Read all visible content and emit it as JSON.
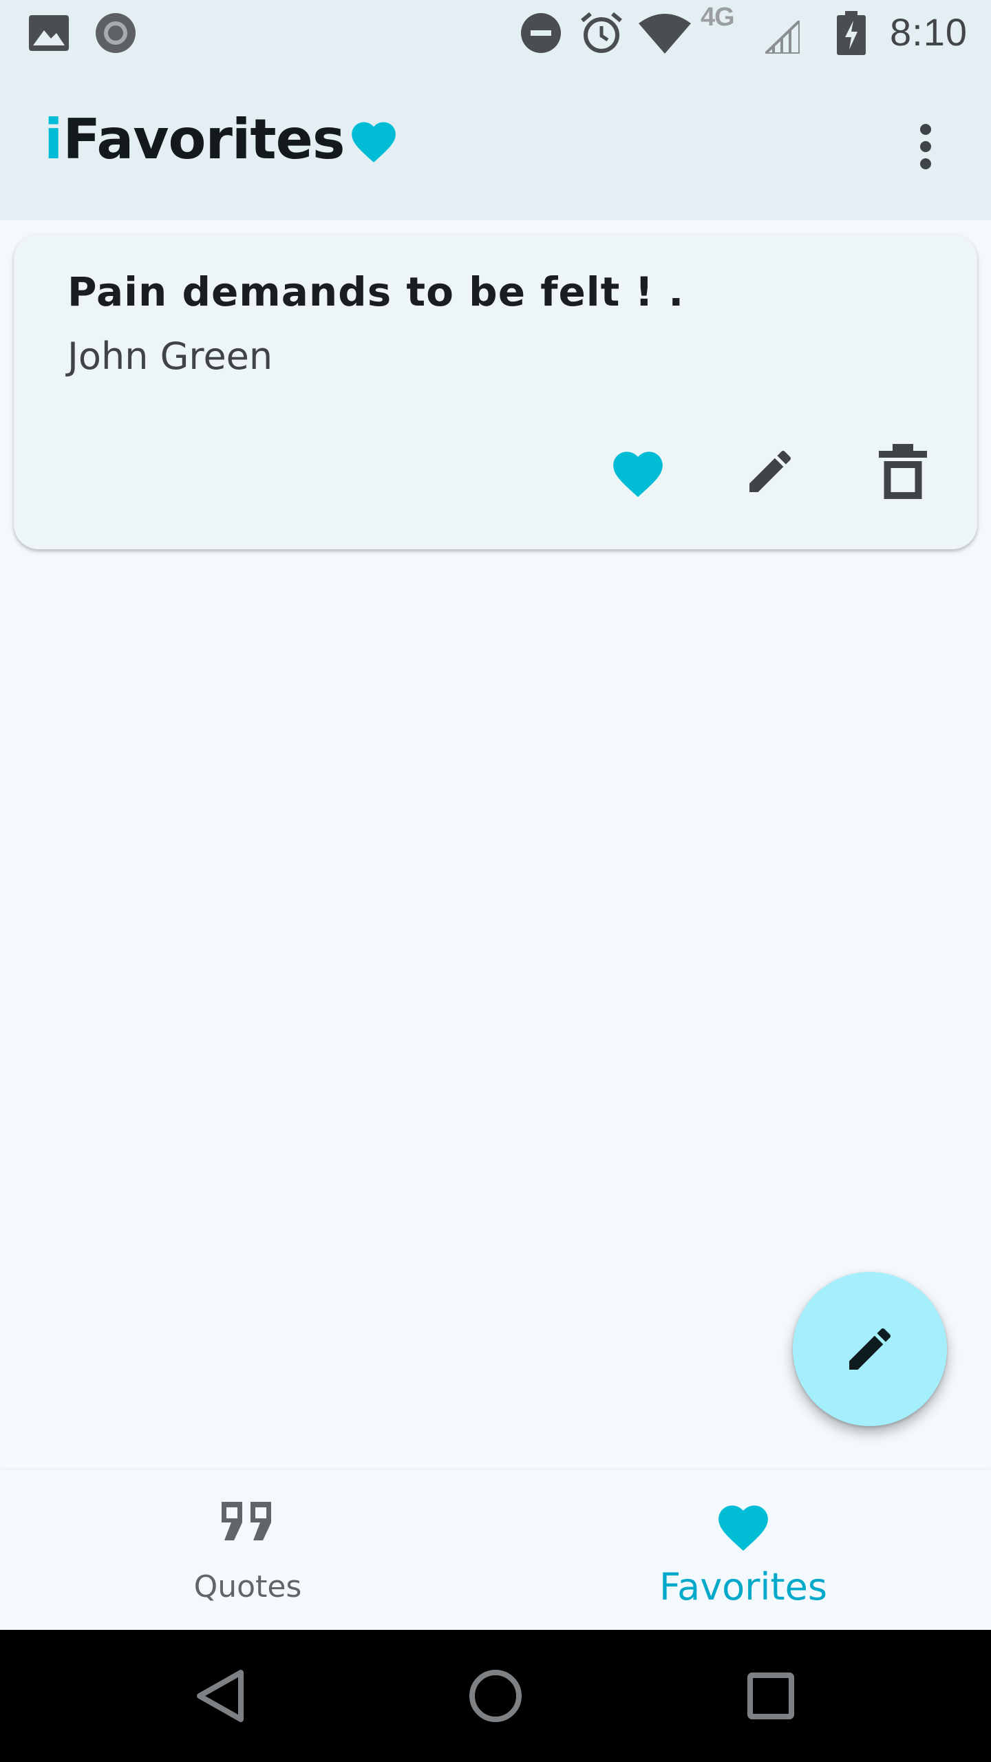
{
  "status_bar": {
    "time": "8:10",
    "network_label": "4G",
    "icons": [
      "image-icon",
      "record-icon",
      "do-not-disturb-icon",
      "alarm-icon",
      "wifi-icon",
      "lte-icon",
      "signal-icon",
      "battery-charging-icon"
    ]
  },
  "app_bar": {
    "title_accent": "i",
    "title_rest": "Favorites",
    "overflow_icon": "more-vert-icon"
  },
  "favorites": [
    {
      "quote": "Pain demands to be felt ! .",
      "author": "John Green",
      "actions": [
        "favorite-icon",
        "edit-icon",
        "delete-icon"
      ]
    }
  ],
  "fab": {
    "icon": "edit-icon"
  },
  "bottom_nav": {
    "items": [
      {
        "label": "Quotes",
        "icon": "format-quote-icon",
        "selected": false
      },
      {
        "label": "Favorites",
        "icon": "favorite-icon",
        "selected": true
      }
    ]
  },
  "colors": {
    "accent": "#00BCD4",
    "app_bar_bg": "#E3EFF2",
    "page_bg": "#F3F9FC",
    "card_bg": "#EEF5F7",
    "fab_bg": "#A4EFFB",
    "selected_nav": "#00A9C9"
  }
}
